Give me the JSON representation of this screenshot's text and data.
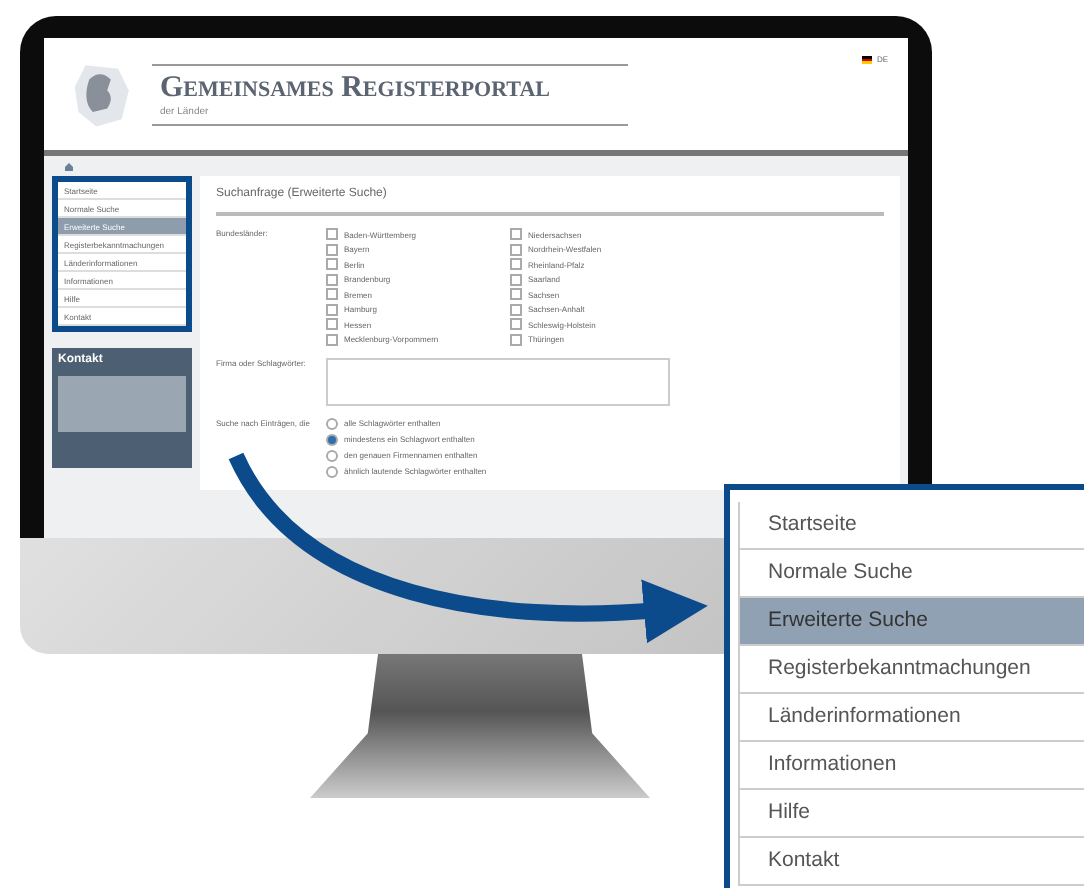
{
  "portal": {
    "title": "Gemeinsames Registerportal",
    "subtitle": "der Länder",
    "language": "DE"
  },
  "sidebar": {
    "items": [
      {
        "label": "Startseite",
        "selected": false
      },
      {
        "label": "Normale Suche",
        "selected": false
      },
      {
        "label": "Erweiterte Suche",
        "selected": true
      },
      {
        "label": "Registerbekanntmachungen",
        "selected": false
      },
      {
        "label": "Länderinformationen",
        "selected": false
      },
      {
        "label": "Informationen",
        "selected": false
      },
      {
        "label": "Hilfe",
        "selected": false
      },
      {
        "label": "Kontakt",
        "selected": false
      }
    ],
    "contact_title": "Kontakt"
  },
  "search_form": {
    "title": "Suchanfrage (Erweiterte Suche)",
    "states_label": "Bundesländer:",
    "states": [
      {
        "label": "Baden-Württemberg",
        "checked": false
      },
      {
        "label": "Bayern",
        "checked": false
      },
      {
        "label": "Berlin",
        "checked": false
      },
      {
        "label": "Brandenburg",
        "checked": false
      },
      {
        "label": "Bremen",
        "checked": false
      },
      {
        "label": "Hamburg",
        "checked": false
      },
      {
        "label": "Hessen",
        "checked": false
      },
      {
        "label": "Mecklenburg-Vorpommern",
        "checked": false
      },
      {
        "label": "Niedersachsen",
        "checked": false
      },
      {
        "label": "Nordrhein-Westfalen",
        "checked": false
      },
      {
        "label": "Rheinland-Pfalz",
        "checked": false
      },
      {
        "label": "Saarland",
        "checked": false
      },
      {
        "label": "Sachsen",
        "checked": false
      },
      {
        "label": "Sachsen-Anhalt",
        "checked": false
      },
      {
        "label": "Schleswig-Holstein",
        "checked": false
      },
      {
        "label": "Thüringen",
        "checked": false
      }
    ],
    "keywords_label": "Firma oder Schlagwörter:",
    "match_label": "Suche nach Einträgen, die",
    "match_options": [
      {
        "label": "alle Schlagwörter enthalten",
        "selected": false
      },
      {
        "label": "mindestens ein Schlagwort enthalten",
        "selected": true
      },
      {
        "label": "den genauen Firmennamen enthalten",
        "selected": false
      },
      {
        "label": "ähnlich lautende Schlagwörter enthalten",
        "selected": false
      }
    ]
  },
  "callout_menu": {
    "items": [
      {
        "label": "Startseite",
        "selected": false
      },
      {
        "label": "Normale Suche",
        "selected": false
      },
      {
        "label": "Erweiterte Suche",
        "selected": true
      },
      {
        "label": "Registerbekanntmachungen",
        "selected": false
      },
      {
        "label": "Länderinformationen",
        "selected": false
      },
      {
        "label": "Informationen",
        "selected": false
      },
      {
        "label": "Hilfe",
        "selected": false
      },
      {
        "label": "Kontakt",
        "selected": false
      }
    ]
  }
}
